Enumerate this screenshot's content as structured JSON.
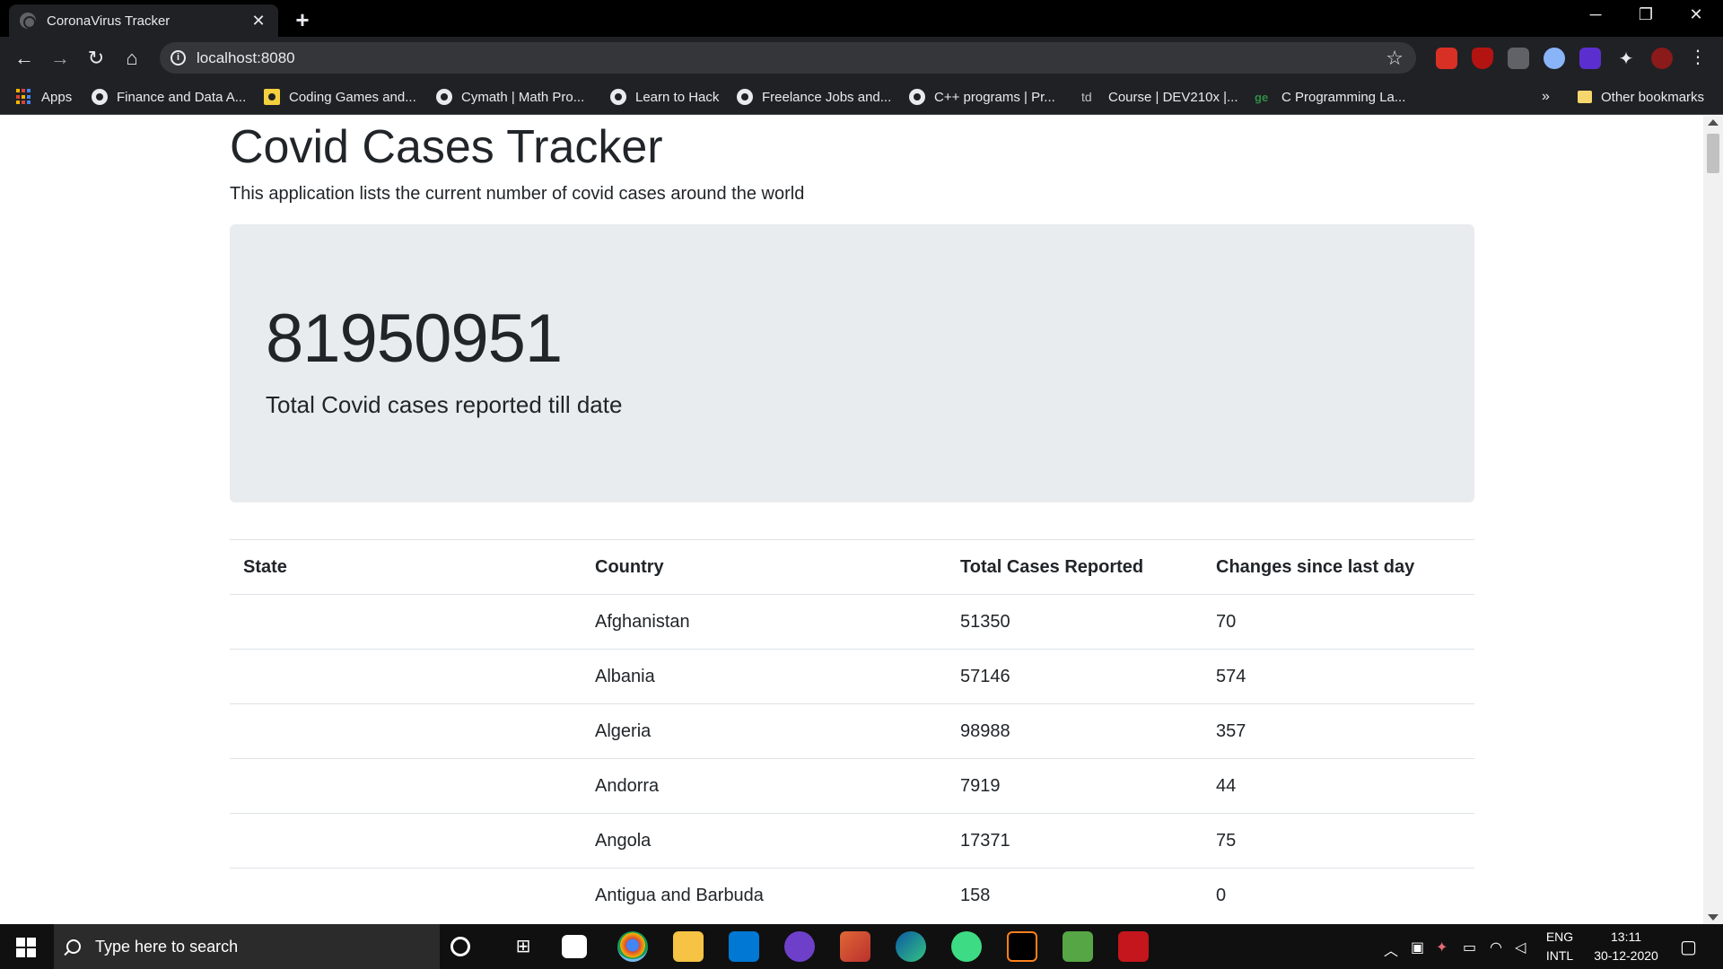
{
  "browser": {
    "tab_title": "CoronaVirus Tracker",
    "url": "localhost:8080",
    "bookmarks": [
      {
        "label": "Apps",
        "icon": "apps-grid-icon"
      },
      {
        "label": "Finance and Data A...",
        "icon": "globe-icon"
      },
      {
        "label": "Coding Games and...",
        "icon": "coding-games-icon"
      },
      {
        "label": "Cymath | Math Pro...",
        "icon": "globe-icon"
      },
      {
        "label": "Learn to Hack",
        "icon": "globe-icon"
      },
      {
        "label": "Freelance Jobs and...",
        "icon": "globe-icon"
      },
      {
        "label": "C++ programs | Pr...",
        "icon": "globe-icon"
      },
      {
        "label": "Course | DEV210x |...",
        "icon": "td-icon"
      },
      {
        "label": "C Programming La...",
        "icon": "gfg-icon"
      }
    ],
    "overflow_label": "»",
    "other_bookmarks": "Other bookmarks"
  },
  "page": {
    "title": "Covid Cases Tracker",
    "subtitle": "This application lists the current number of covid cases around the world",
    "total_cases": "81950951",
    "total_caption": "Total Covid cases reported till date",
    "table": {
      "headers": [
        "State",
        "Country",
        "Total Cases Reported",
        "Changes since last day"
      ],
      "rows": [
        [
          "",
          "Afghanistan",
          "51350",
          "70"
        ],
        [
          "",
          "Albania",
          "57146",
          "574"
        ],
        [
          "",
          "Algeria",
          "98988",
          "357"
        ],
        [
          "",
          "Andorra",
          "7919",
          "44"
        ],
        [
          "",
          "Angola",
          "17371",
          "75"
        ],
        [
          "",
          "Antigua and Barbuda",
          "158",
          "0"
        ]
      ]
    }
  },
  "taskbar": {
    "search_placeholder": "Type here to search",
    "lang_top": "ENG",
    "lang_bottom": "INTL",
    "time": "13:11",
    "date": "30-12-2020"
  },
  "colors": {
    "jumbotron_bg": "#e9ecef",
    "text": "#212529",
    "chrome_dark": "#202124",
    "taskbar": "#101010"
  }
}
